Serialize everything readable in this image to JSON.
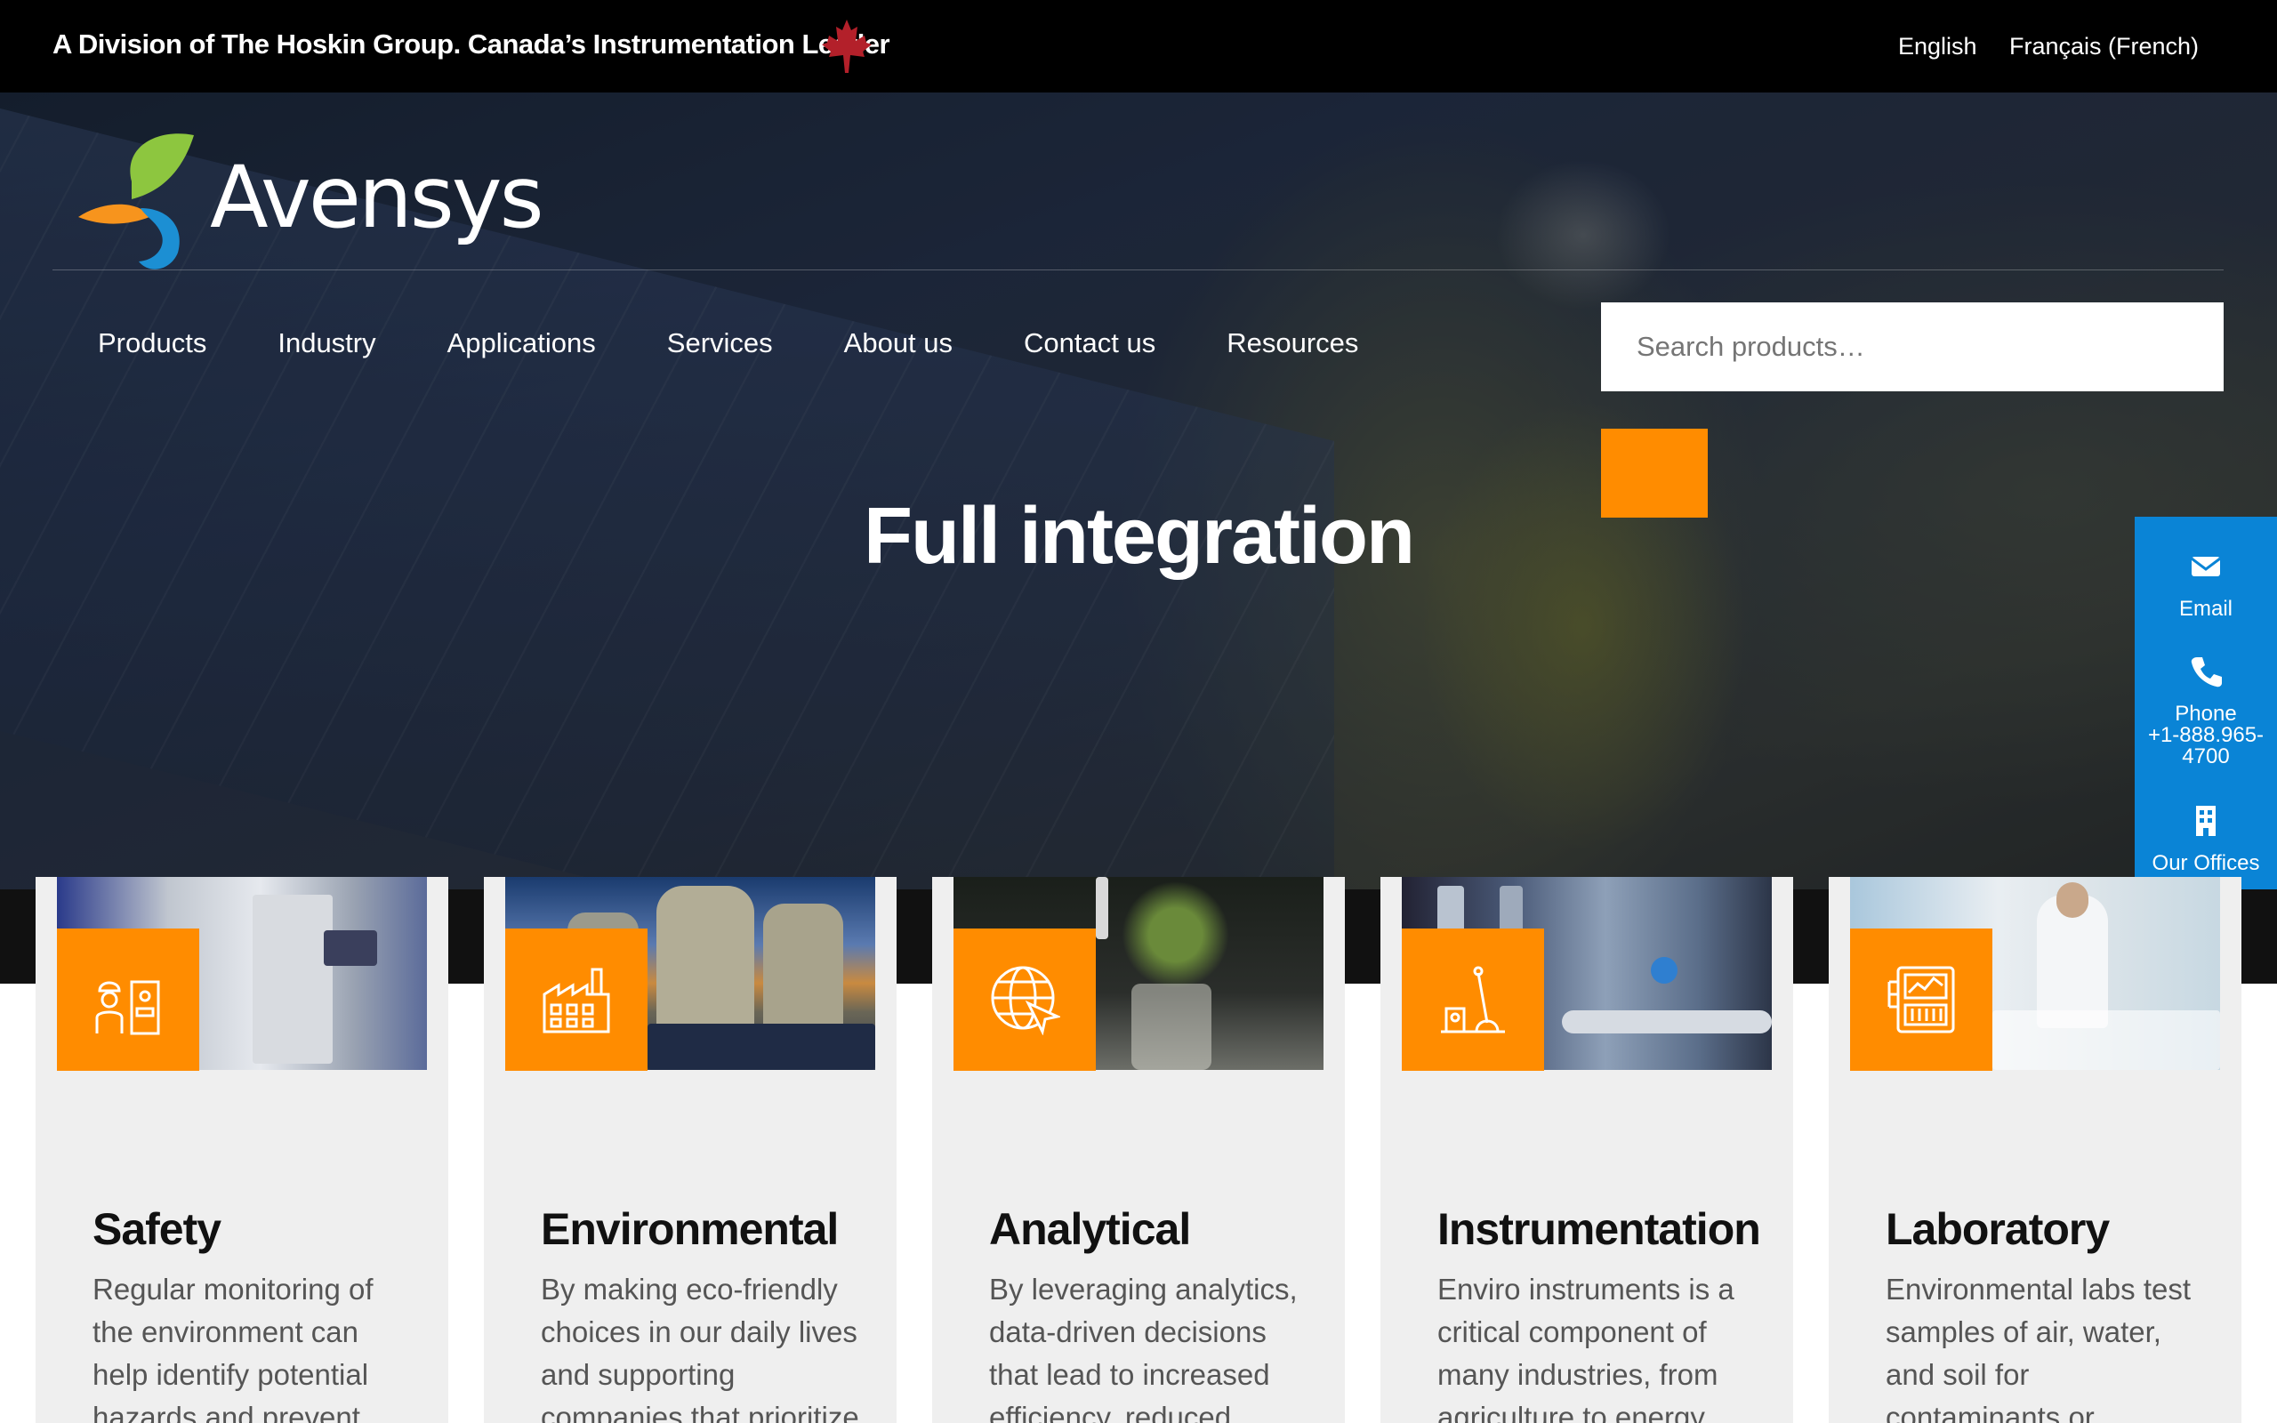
{
  "topbar": {
    "division_text": "A Division of The Hoskin Group. Canada’s Instrumentation Leader",
    "languages": [
      "English",
      "Français (French)"
    ]
  },
  "brand": {
    "name": "Avensys"
  },
  "nav": {
    "items": [
      "Products",
      "Industry",
      "Applications",
      "Services",
      "About us",
      "Contact us",
      "Resources"
    ]
  },
  "search": {
    "placeholder": "Search products…"
  },
  "hero": {
    "title": "Full integration"
  },
  "contact": {
    "email_label": "Email",
    "phone_label": "Phone",
    "phone_number": "+1-888.965-4700",
    "offices_label": "Our Offices"
  },
  "cards": [
    {
      "title": "Safety",
      "text": "Regular monitoring of the environment can help identify potential hazards and prevent"
    },
    {
      "title": "Environmental",
      "text": "By making eco-friendly choices in our daily lives and supporting companies that prioritize"
    },
    {
      "title": "Analytical",
      "text": "By leveraging analytics, data-driven decisions that lead to increased efficiency, reduced"
    },
    {
      "title": "Instrumentation",
      "text": "Enviro instruments is a critical component of many industries, from agriculture to energy"
    },
    {
      "title": "Laboratory",
      "text": "Environmental labs test samples of air, water, and soil for contaminants or pollutants. They may"
    }
  ],
  "colors": {
    "accent": "#ff8c00",
    "contact_blue": "#0a84d6",
    "topbar": "#000000",
    "card_bg": "#efefef"
  }
}
